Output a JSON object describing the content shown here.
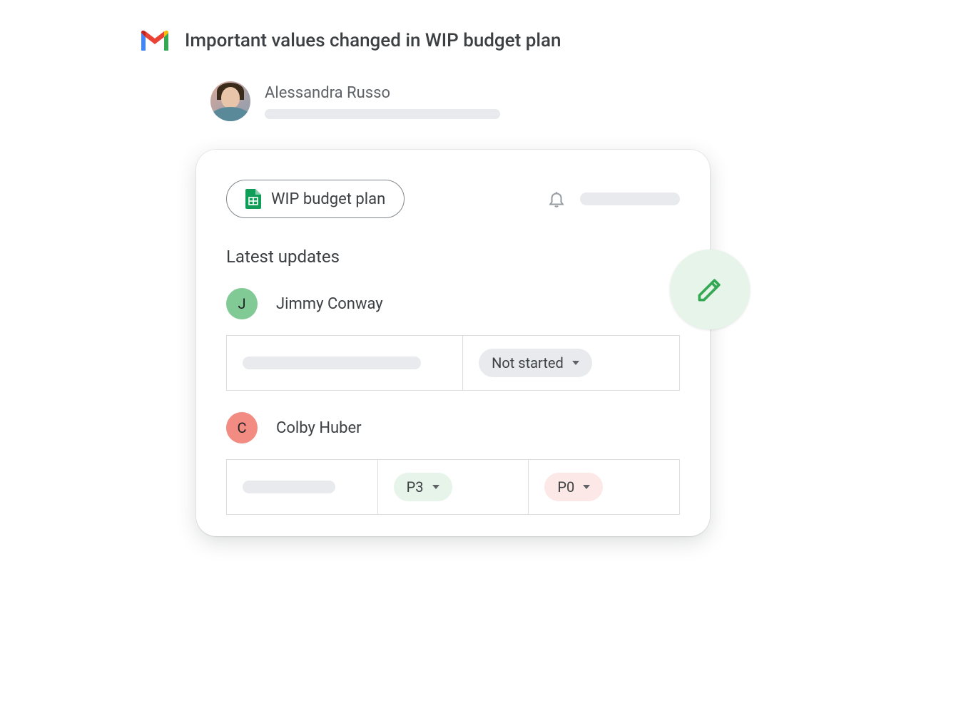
{
  "email": {
    "subject": "Important values changed in WIP budget plan",
    "sender": {
      "name": "Alessandra Russo"
    }
  },
  "card": {
    "doc_chip_label": "WIP budget plan",
    "section_title": "Latest updates",
    "updates": [
      {
        "avatar_initial": "J",
        "avatar_color": "green",
        "name": "Jimmy Conway",
        "row_type": "status",
        "status_label": "Not started"
      },
      {
        "avatar_initial": "C",
        "avatar_color": "red",
        "name": "Colby Huber",
        "row_type": "priority",
        "priority_from": "P3",
        "priority_to": "P0"
      }
    ]
  }
}
